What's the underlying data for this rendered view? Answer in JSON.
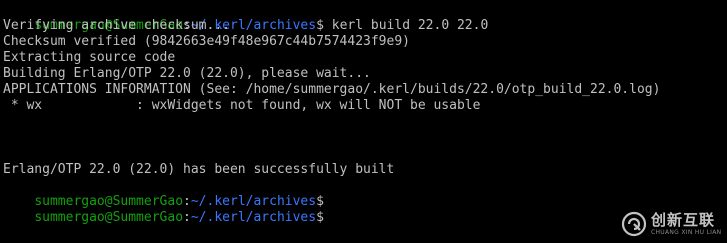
{
  "terminal": {
    "prompt_user": "summergao@SummerGao",
    "prompt_sep": ":",
    "prompt_path": "~/.kerl/archives",
    "prompt_symbol": "$",
    "command": " kerl build 22.0 22.0",
    "output": [
      "Verifying archive checksum...",
      "Checksum verified (9842663e49f48e967c44b7574423f9e9)",
      "Extracting source code",
      "Building Erlang/OTP 22.0 (22.0), please wait...",
      "APPLICATIONS INFORMATION (See: /home/summergao/.kerl/builds/22.0/otp_build_22.0.log)",
      " * wx            : wxWidgets not found, wx will NOT be usable"
    ],
    "success_message": "Erlang/OTP 22.0 (22.0) has been successfully built"
  },
  "watermark": {
    "logo_icon": "chuangxin-logo-icon",
    "text_cn": "创新互联",
    "text_en": "CHUANG XIN HU LIAN"
  },
  "colors": {
    "background": "#000000",
    "text": "#c0c0c0",
    "prompt_user": "#13a10e",
    "prompt_path": "#3b78ff"
  }
}
